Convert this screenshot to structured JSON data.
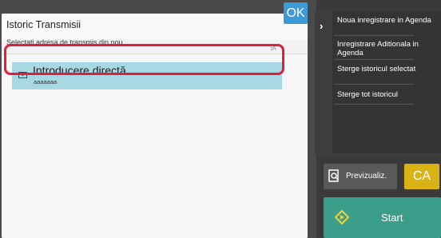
{
  "dialog": {
    "title": "Istoric Transmisii",
    "ok_label": "OK",
    "subtitle": "Selectati adresa de transmis din nou."
  },
  "list": {
    "items": [
      {
        "name": "Introducere directă",
        "address": "aaaaaaa",
        "icon": "mail-icon",
        "selected": true
      }
    ]
  },
  "sidebar": {
    "items": [
      {
        "label": "Noua inregistrare in Agenda"
      },
      {
        "label": "Inregistrare Aditionala in Agenda"
      },
      {
        "label": "Sterge istoricul selectat"
      },
      {
        "label": "Sterge tot istoricul"
      }
    ]
  },
  "footer": {
    "preview_label": "Previzualiz.",
    "ca_label": "CA",
    "start_label": "Start"
  },
  "colors": {
    "accent": "#3c9ad6",
    "selection": "#a8d8e4",
    "highlight": "#e0203a",
    "ca": "#d9b215",
    "start": "#3a9e8a"
  }
}
